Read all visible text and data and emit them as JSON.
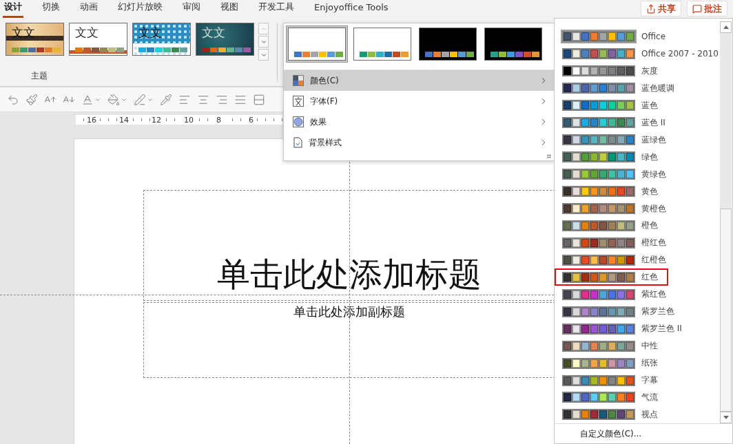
{
  "tabs": [
    {
      "label": "设计",
      "selected": true
    },
    {
      "label": "切换",
      "selected": false
    },
    {
      "label": "动画",
      "selected": false
    },
    {
      "label": "幻灯片放映",
      "selected": false
    },
    {
      "label": "审阅",
      "selected": false
    },
    {
      "label": "视图",
      "selected": false
    },
    {
      "label": "开发工具",
      "selected": false
    },
    {
      "label": "Enjoyoffice Tools",
      "selected": false
    }
  ],
  "header_buttons": [
    {
      "kind": "share",
      "label": "共享"
    },
    {
      "kind": "comment",
      "label": "批注"
    }
  ],
  "themes": {
    "label": "主题",
    "items": [
      {
        "kind": "wood",
        "sample": "文文",
        "swatches": [
          {
            "color": "#8da13b"
          },
          {
            "color": "#3f9a74"
          },
          {
            "color": "#4d6ea2"
          },
          {
            "color": "#a8392d"
          },
          {
            "color": "#e07b2a"
          },
          {
            "color": "#e8b434"
          }
        ]
      },
      {
        "kind": "plain",
        "sample": "文文",
        "swatches": [
          {
            "color": "#e07b12"
          },
          {
            "color": "#bf5a2c"
          },
          {
            "color": "#865640"
          },
          {
            "color": "#9b8357"
          },
          {
            "color": "#c2bc80"
          },
          {
            "color": "#94a088"
          }
        ]
      },
      {
        "kind": "pattern",
        "sample": "文文",
        "swatches": [
          {
            "color": "#1cade4"
          },
          {
            "color": "#2683c6"
          },
          {
            "color": "#27ced7"
          },
          {
            "color": "#42ba97"
          },
          {
            "color": "#3e8853"
          },
          {
            "color": "#62a39f"
          }
        ]
      },
      {
        "kind": "dark",
        "sample": "文文",
        "swatches": [
          {
            "color": "#a5201a"
          },
          {
            "color": "#e8610f"
          },
          {
            "color": "#e8b41c"
          },
          {
            "color": "#65b08c"
          },
          {
            "color": "#5a8aa8"
          },
          {
            "color": "#9d5aa0"
          }
        ]
      }
    ]
  },
  "toolbar": [
    {
      "kind": "reset",
      "dropdown": false
    },
    {
      "kind": "painter",
      "dropdown": false
    },
    {
      "kind": "grow",
      "dropdown": false
    },
    {
      "kind": "shrink",
      "dropdown": false
    },
    {
      "kind": "font_color",
      "dropdown": true
    },
    {
      "kind": "fill",
      "dropdown": true
    },
    {
      "kind": "outline",
      "dropdown": true
    },
    {
      "kind": "eyedropper",
      "dropdown": false
    },
    {
      "kind": "align_left",
      "dropdown": false
    },
    {
      "kind": "align_center",
      "dropdown": false
    },
    {
      "kind": "align_right",
      "dropdown": false
    },
    {
      "kind": "justify",
      "dropdown": false
    },
    {
      "kind": "direction",
      "dropdown": false
    }
  ],
  "ruler": {
    "labels": [
      "16",
      "14",
      "12",
      "10",
      "8",
      "6"
    ]
  },
  "slide": {
    "title": "单击此处添加标题",
    "subtitle": "单击此处添加副标题"
  },
  "variants_menu": {
    "variants": [
      {
        "kind": "light",
        "selected": true,
        "swatches": [
          {
            "color": "#4472c4"
          },
          {
            "color": "#ed7d31"
          },
          {
            "color": "#a5a5a5"
          },
          {
            "color": "#ffc000"
          },
          {
            "color": "#5b9bd5"
          },
          {
            "color": "#70ad47"
          }
        ]
      },
      {
        "kind": "light",
        "selected": false,
        "swatches": [
          {
            "color": "#199a79"
          },
          {
            "color": "#8cbc43"
          },
          {
            "color": "#32acc7"
          },
          {
            "color": "#1f6ea8"
          },
          {
            "color": "#c64a1c"
          },
          {
            "color": "#f59a26"
          }
        ]
      },
      {
        "kind": "dark",
        "selected": false,
        "swatches": [
          {
            "color": "#4472c4"
          },
          {
            "color": "#ed7d31"
          },
          {
            "color": "#a5a5a5"
          },
          {
            "color": "#ffc000"
          },
          {
            "color": "#5b9bd5"
          },
          {
            "color": "#70ad47"
          }
        ]
      },
      {
        "kind": "dark",
        "selected": false,
        "swatches": [
          {
            "color": "#1fa58a"
          },
          {
            "color": "#8fbc3b"
          },
          {
            "color": "#3a9bd6"
          },
          {
            "color": "#7b52c8"
          },
          {
            "color": "#d34a2c"
          },
          {
            "color": "#e09532"
          }
        ]
      }
    ],
    "items": [
      {
        "kind": "colors",
        "label": "颜色(C)",
        "selected": true
      },
      {
        "kind": "fonts",
        "label": "字体(F)",
        "selected": false
      },
      {
        "kind": "effects",
        "label": "效果",
        "selected": false
      },
      {
        "kind": "background",
        "label": "背景样式",
        "selected": false
      }
    ]
  },
  "colors_menu": {
    "themes": [
      {
        "name": "Office",
        "selected": true,
        "outlined": false,
        "swatches": [
          {
            "color": "#44546a"
          },
          {
            "color": "#e7e6e6"
          },
          {
            "color": "#4472c4"
          },
          {
            "color": "#ed7d31"
          },
          {
            "color": "#a5a5a5"
          },
          {
            "color": "#ffc000"
          },
          {
            "color": "#5b9bd5"
          },
          {
            "color": "#70ad47"
          }
        ]
      },
      {
        "name": "Office 2007 - 2010",
        "selected": false,
        "outlined": false,
        "swatches": [
          {
            "color": "#1f497d"
          },
          {
            "color": "#eeece1"
          },
          {
            "color": "#4f81bd"
          },
          {
            "color": "#c0504d"
          },
          {
            "color": "#9bbb59"
          },
          {
            "color": "#8064a2"
          },
          {
            "color": "#4bacc6"
          },
          {
            "color": "#f79646"
          }
        ]
      },
      {
        "name": "灰度",
        "selected": false,
        "outlined": false,
        "swatches": [
          {
            "color": "#000000"
          },
          {
            "color": "#f8f8f8"
          },
          {
            "color": "#dddddd"
          },
          {
            "color": "#b2b2b2"
          },
          {
            "color": "#969696"
          },
          {
            "color": "#808080"
          },
          {
            "color": "#5f5f5f"
          },
          {
            "color": "#4d4d4d"
          }
        ]
      },
      {
        "name": "蓝色暖调",
        "selected": false,
        "outlined": false,
        "swatches": [
          {
            "color": "#242852"
          },
          {
            "color": "#acccea"
          },
          {
            "color": "#4a66ac"
          },
          {
            "color": "#629dd1"
          },
          {
            "color": "#297fd5"
          },
          {
            "color": "#7f8fa9"
          },
          {
            "color": "#5aa2ae"
          },
          {
            "color": "#9d90a0"
          }
        ]
      },
      {
        "name": "蓝色",
        "selected": false,
        "outlined": false,
        "swatches": [
          {
            "color": "#17406d"
          },
          {
            "color": "#dbeff9"
          },
          {
            "color": "#0f6fc6"
          },
          {
            "color": "#009dd9"
          },
          {
            "color": "#0bd0d9"
          },
          {
            "color": "#10cf9b"
          },
          {
            "color": "#7cca62"
          },
          {
            "color": "#a5c249"
          }
        ]
      },
      {
        "name": "蓝色 II",
        "selected": false,
        "outlined": false,
        "swatches": [
          {
            "color": "#335b74"
          },
          {
            "color": "#dfe3e5"
          },
          {
            "color": "#1cade4"
          },
          {
            "color": "#2683c6"
          },
          {
            "color": "#27ced7"
          },
          {
            "color": "#42ba97"
          },
          {
            "color": "#3e8853"
          },
          {
            "color": "#62a39f"
          }
        ]
      },
      {
        "name": "蓝绿色",
        "selected": false,
        "outlined": false,
        "swatches": [
          {
            "color": "#373545"
          },
          {
            "color": "#cedbe6"
          },
          {
            "color": "#3494ba"
          },
          {
            "color": "#58b6c0"
          },
          {
            "color": "#75bda7"
          },
          {
            "color": "#7a8c8e"
          },
          {
            "color": "#84acb6"
          },
          {
            "color": "#2683c6"
          }
        ]
      },
      {
        "name": "绿色",
        "selected": false,
        "outlined": false,
        "swatches": [
          {
            "color": "#455f51"
          },
          {
            "color": "#e3ded1"
          },
          {
            "color": "#549e39"
          },
          {
            "color": "#8ab833"
          },
          {
            "color": "#c0cf3a"
          },
          {
            "color": "#029676"
          },
          {
            "color": "#4ab5c4"
          },
          {
            "color": "#0989b1"
          }
        ]
      },
      {
        "name": "黄绿色",
        "selected": false,
        "outlined": false,
        "swatches": [
          {
            "color": "#455f51"
          },
          {
            "color": "#e3ded1"
          },
          {
            "color": "#99cb38"
          },
          {
            "color": "#63a537"
          },
          {
            "color": "#37a76f"
          },
          {
            "color": "#44c1a3"
          },
          {
            "color": "#4eb3cf"
          },
          {
            "color": "#51c3f9"
          }
        ]
      },
      {
        "name": "黄色",
        "selected": false,
        "outlined": false,
        "swatches": [
          {
            "color": "#39302a"
          },
          {
            "color": "#e5dedb"
          },
          {
            "color": "#ffca08"
          },
          {
            "color": "#f8931d"
          },
          {
            "color": "#ce8d3e"
          },
          {
            "color": "#ec7016"
          },
          {
            "color": "#e64823"
          },
          {
            "color": "#9c6a6a"
          }
        ]
      },
      {
        "name": "黄橙色",
        "selected": false,
        "outlined": false,
        "swatches": [
          {
            "color": "#4e3b30"
          },
          {
            "color": "#fbeec9"
          },
          {
            "color": "#f0a22e"
          },
          {
            "color": "#a5644e"
          },
          {
            "color": "#b58b80"
          },
          {
            "color": "#c3986d"
          },
          {
            "color": "#a19574"
          },
          {
            "color": "#c17529"
          }
        ]
      },
      {
        "name": "橙色",
        "selected": false,
        "outlined": false,
        "swatches": [
          {
            "color": "#637052"
          },
          {
            "color": "#ccddea"
          },
          {
            "color": "#e48312"
          },
          {
            "color": "#bd582c"
          },
          {
            "color": "#865640"
          },
          {
            "color": "#9b8357"
          },
          {
            "color": "#c2bc80"
          },
          {
            "color": "#94a088"
          }
        ]
      },
      {
        "name": "橙红色",
        "selected": false,
        "outlined": false,
        "swatches": [
          {
            "color": "#696464"
          },
          {
            "color": "#e9e5dc"
          },
          {
            "color": "#d34817"
          },
          {
            "color": "#9b2d1f"
          },
          {
            "color": "#a28e6a"
          },
          {
            "color": "#956251"
          },
          {
            "color": "#918485"
          },
          {
            "color": "#855d5d"
          }
        ]
      },
      {
        "name": "红橙色",
        "selected": false,
        "outlined": false,
        "swatches": [
          {
            "color": "#505046"
          },
          {
            "color": "#eeece1"
          },
          {
            "color": "#e84c22"
          },
          {
            "color": "#ffbd47"
          },
          {
            "color": "#b64926"
          },
          {
            "color": "#ff8427"
          },
          {
            "color": "#cc9900"
          },
          {
            "color": "#b22600"
          }
        ]
      },
      {
        "name": "红色",
        "selected": false,
        "outlined": true,
        "swatches": [
          {
            "color": "#323232"
          },
          {
            "color": "#e5c243"
          },
          {
            "color": "#a5300f"
          },
          {
            "color": "#d55816"
          },
          {
            "color": "#e19825"
          },
          {
            "color": "#b19c7d"
          },
          {
            "color": "#7f5f52"
          },
          {
            "color": "#b27d49"
          }
        ]
      },
      {
        "name": "紫红色",
        "selected": false,
        "outlined": false,
        "swatches": [
          {
            "color": "#454551"
          },
          {
            "color": "#d8d9dc"
          },
          {
            "color": "#e32d91"
          },
          {
            "color": "#c830cc"
          },
          {
            "color": "#4ea6dc"
          },
          {
            "color": "#4775e7"
          },
          {
            "color": "#8971e1"
          },
          {
            "color": "#d54773"
          }
        ]
      },
      {
        "name": "紫罗兰色",
        "selected": false,
        "outlined": false,
        "swatches": [
          {
            "color": "#373545"
          },
          {
            "color": "#dcd8dc"
          },
          {
            "color": "#ad84c6"
          },
          {
            "color": "#8784c7"
          },
          {
            "color": "#5d739a"
          },
          {
            "color": "#6997af"
          },
          {
            "color": "#84acb6"
          },
          {
            "color": "#6f8183"
          }
        ]
      },
      {
        "name": "紫罗兰色 II",
        "selected": false,
        "outlined": false,
        "swatches": [
          {
            "color": "#632e62"
          },
          {
            "color": "#eae5eb"
          },
          {
            "color": "#92278f"
          },
          {
            "color": "#9b57d3"
          },
          {
            "color": "#755dd9"
          },
          {
            "color": "#665eb8"
          },
          {
            "color": "#45a5ed"
          },
          {
            "color": "#5982db"
          }
        ]
      },
      {
        "name": "中性",
        "selected": false,
        "outlined": false,
        "swatches": [
          {
            "color": "#745a53"
          },
          {
            "color": "#ebdcc3"
          },
          {
            "color": "#96b3d0"
          },
          {
            "color": "#e0834e"
          },
          {
            "color": "#a3ad83"
          },
          {
            "color": "#dbb05c"
          },
          {
            "color": "#7da598"
          },
          {
            "color": "#968c8c"
          }
        ]
      },
      {
        "name": "纸张",
        "selected": false,
        "outlined": false,
        "swatches": [
          {
            "color": "#444d26"
          },
          {
            "color": "#fefac9"
          },
          {
            "color": "#a5b592"
          },
          {
            "color": "#f3a447"
          },
          {
            "color": "#e7bc29"
          },
          {
            "color": "#d092a7"
          },
          {
            "color": "#9c85c0"
          },
          {
            "color": "#809ec2"
          }
        ]
      },
      {
        "name": "字幕",
        "selected": false,
        "outlined": false,
        "swatches": [
          {
            "color": "#5a5a5a"
          },
          {
            "color": "#dddddd"
          },
          {
            "color": "#3d8bb7"
          },
          {
            "color": "#a8b725"
          },
          {
            "color": "#f39200"
          },
          {
            "color": "#848484"
          },
          {
            "color": "#ffc000"
          },
          {
            "color": "#e0541f"
          }
        ]
      },
      {
        "name": "气流",
        "selected": false,
        "outlined": false,
        "swatches": [
          {
            "color": "#212745"
          },
          {
            "color": "#b4dcfa"
          },
          {
            "color": "#4e67c8"
          },
          {
            "color": "#5eccf3"
          },
          {
            "color": "#a7ea52"
          },
          {
            "color": "#5dceaf"
          },
          {
            "color": "#ff8021"
          },
          {
            "color": "#f14124"
          }
        ]
      },
      {
        "name": "视点",
        "selected": false,
        "outlined": false,
        "swatches": [
          {
            "color": "#323232"
          },
          {
            "color": "#e3ded1"
          },
          {
            "color": "#f07f09"
          },
          {
            "color": "#9f2936"
          },
          {
            "color": "#1b587c"
          },
          {
            "color": "#4e8542"
          },
          {
            "color": "#604878"
          },
          {
            "color": "#c19859"
          }
        ]
      }
    ],
    "footer": "自定义颜色(C)..."
  }
}
